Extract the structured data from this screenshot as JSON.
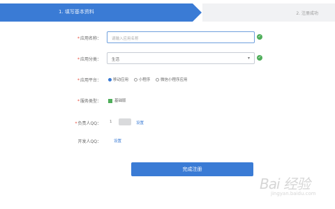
{
  "steps": [
    {
      "label": "1. 填写基本资料",
      "active": true
    },
    {
      "label": "2. 注册成功",
      "active": false
    }
  ],
  "form": {
    "app_name": {
      "label": "应用名称：",
      "placeholder": "请输入应用名称"
    },
    "category": {
      "label": "应用分类：",
      "value": "生活"
    },
    "platform": {
      "label": "应用平台：",
      "options": [
        "移动应用",
        "小程序",
        "微信小程序应用"
      ],
      "selected": 0
    },
    "service": {
      "label": "服务类型：",
      "option": "基础版"
    },
    "owner_qq": {
      "label": "负责人QQ：",
      "prefix": "1",
      "action": "设置"
    },
    "dev_qq": {
      "label": "开发人QQ：",
      "action": "设置"
    }
  },
  "submit_label": "完成注册",
  "watermark": {
    "logo": "Bai 经验",
    "url": "jingyan.baidu.com"
  },
  "colors": {
    "primary": "#3a7bd5",
    "success": "#4fae5a",
    "required": "#e74c3c"
  }
}
